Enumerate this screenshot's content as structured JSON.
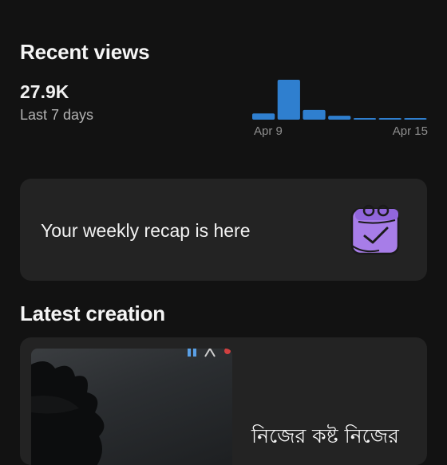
{
  "recent_views": {
    "title": "Recent views",
    "value": "27.9K",
    "period": "Last 7 days"
  },
  "chart_data": {
    "type": "bar",
    "categories": [
      "Apr 9",
      "Apr 10",
      "Apr 11",
      "Apr 12",
      "Apr 13",
      "Apr 14",
      "Apr 15"
    ],
    "values": [
      1.6,
      10.3,
      2.5,
      1.0,
      0.4,
      0.4,
      0.4
    ],
    "tick_labels": [
      "Apr 9",
      "Apr 15"
    ],
    "color": "#2f7fcf"
  },
  "recap": {
    "text": "Your weekly recap is here",
    "icon": "calendar-check-icon",
    "icon_color": "#a77de8"
  },
  "latest_creation": {
    "title": "Latest creation",
    "caption": "নিজের কষ্ট নিজের"
  }
}
